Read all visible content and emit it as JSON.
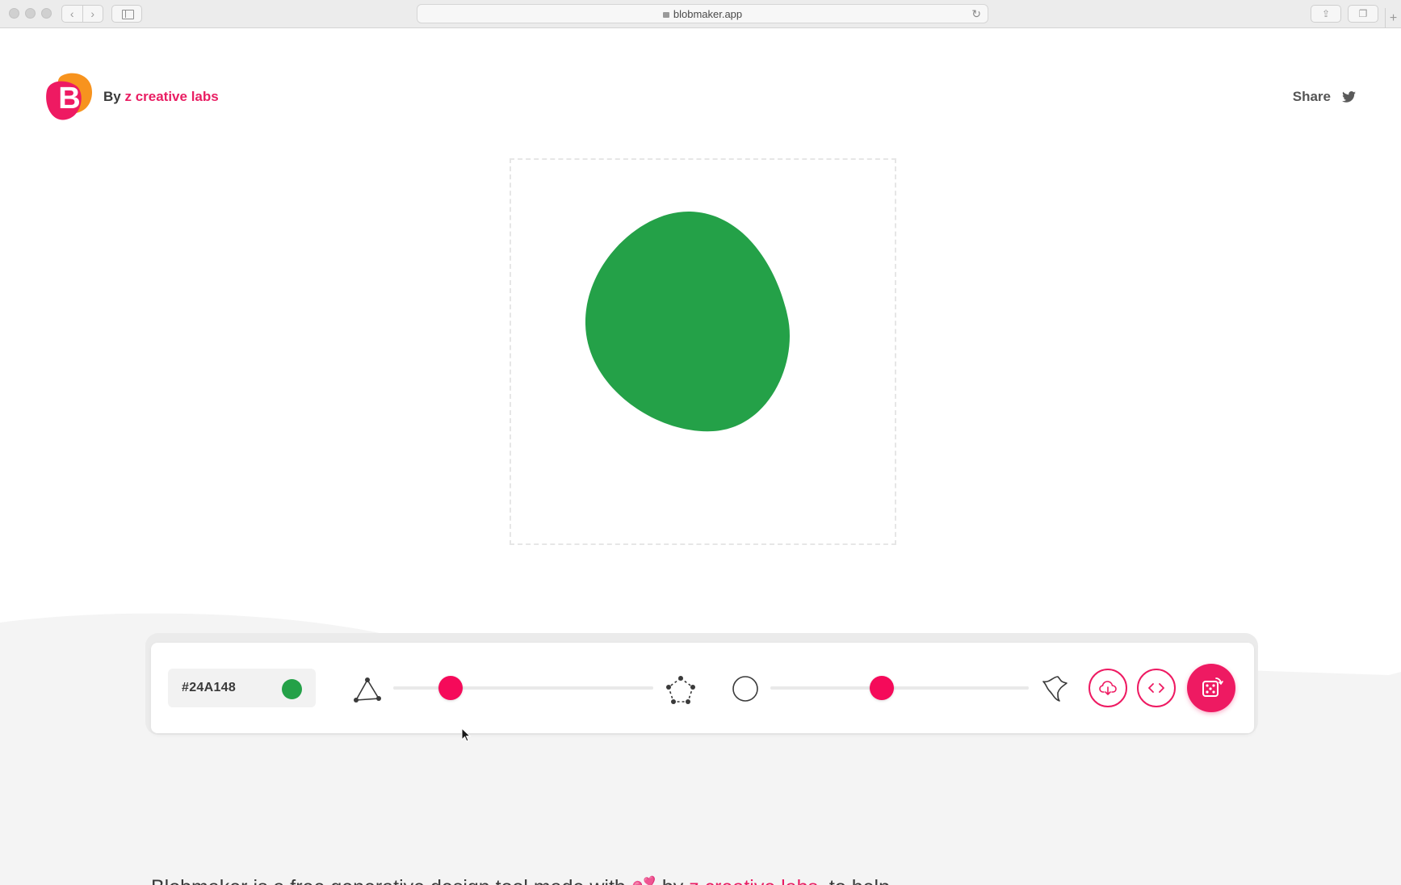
{
  "browser": {
    "url": "blobmaker.app",
    "back_glyph": "‹",
    "forward_glyph": "›",
    "reload_glyph": "↻",
    "share_glyph": "⇪",
    "tabs_glyph": "❐",
    "newtab_glyph": "+"
  },
  "header": {
    "by_text": "By",
    "company_link": "z creative labs",
    "share_label": "Share"
  },
  "logo": {
    "letter": "B"
  },
  "blob": {
    "color": "#24A148"
  },
  "toolbar": {
    "color_hex": "#24A148",
    "complexity_level": 0.22,
    "contrast_level": 0.43
  },
  "about": {
    "text_prefix": "Blobmaker is a free generative design tool made with",
    "emoji": "💕",
    "text_by": "by",
    "link": "z creative labs",
    "text_suffix": ", to help"
  },
  "colors": {
    "accent": "#EE1A62",
    "slider_thumb": "#F50A5A",
    "logo_orange": "#F7931E",
    "logo_pink": "#EE1A62"
  }
}
